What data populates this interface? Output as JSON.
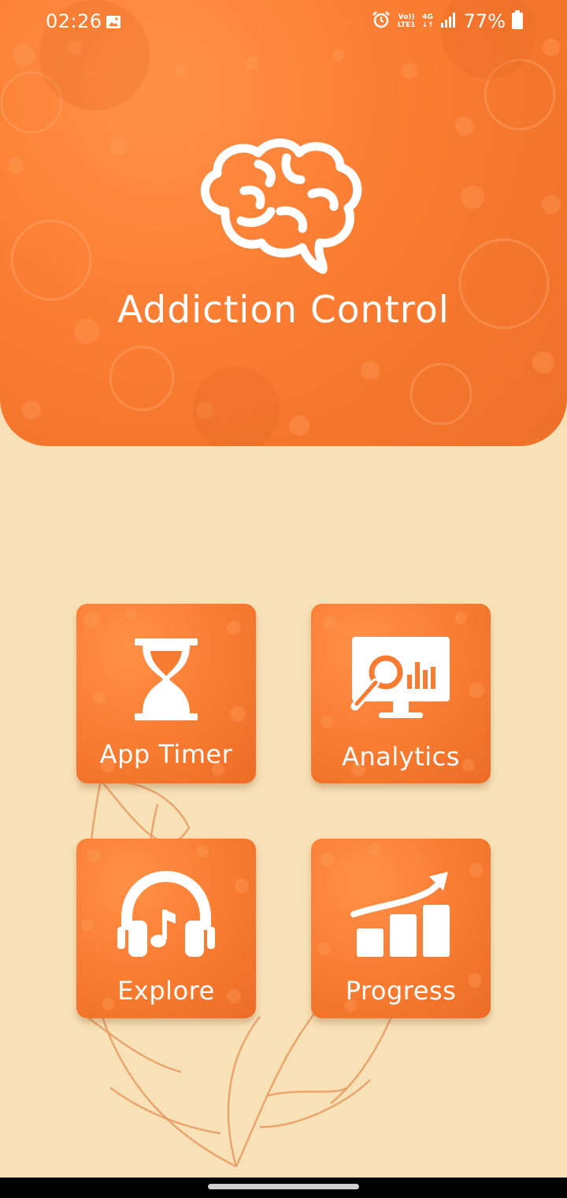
{
  "status_bar": {
    "time": "02:26",
    "network_top": "Vo))",
    "network_bottom": "LTE1",
    "network_gen": "4G",
    "battery_percent": "77%",
    "icons": [
      "gallery-icon",
      "alarm-icon",
      "signal-icon",
      "battery-icon"
    ]
  },
  "header": {
    "title": "Addiction Control",
    "icon": "brain-icon"
  },
  "tiles": [
    {
      "label": "App Timer",
      "icon": "hourglass-icon"
    },
    {
      "label": "Analytics",
      "icon": "analytics-monitor-icon"
    },
    {
      "label": "Explore",
      "icon": "headphones-music-icon"
    },
    {
      "label": "Progress",
      "icon": "growth-chart-icon"
    }
  ],
  "colors": {
    "accent": "#f77b31",
    "background": "#f8e1b6",
    "text_on_accent": "#ffffff"
  }
}
